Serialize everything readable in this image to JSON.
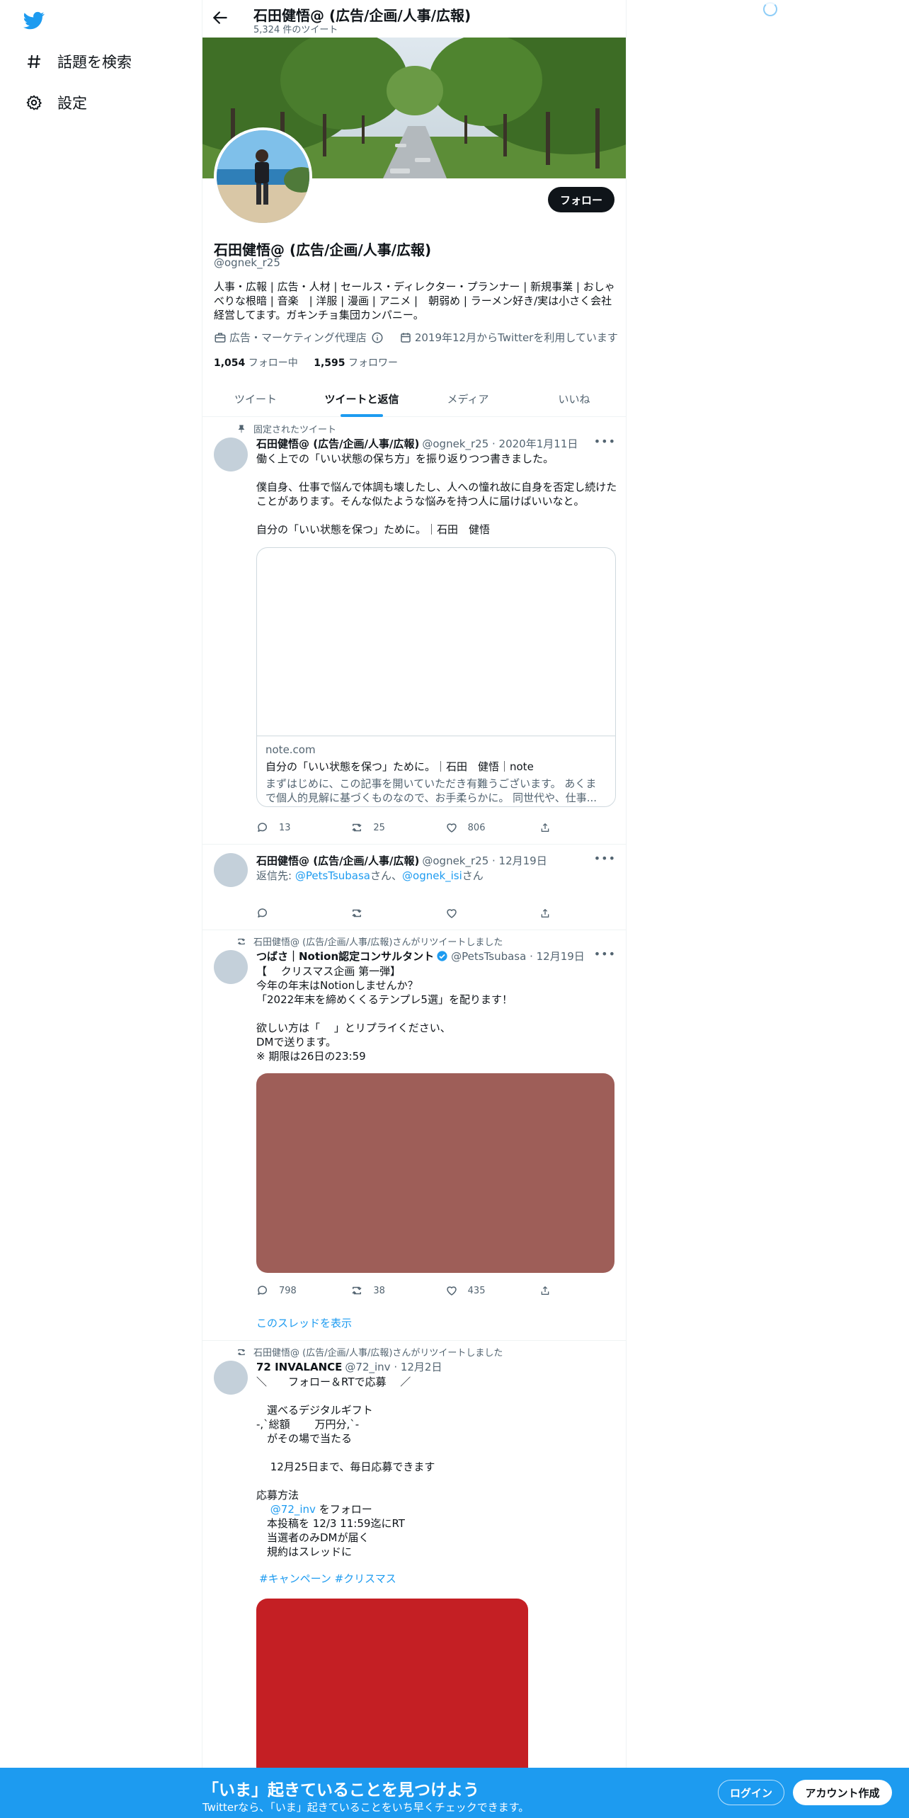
{
  "nav": {
    "items": [
      {
        "label": "話題を検索",
        "icon": "hashtag-icon"
      },
      {
        "label": "設定",
        "icon": "gear-icon"
      }
    ]
  },
  "header": {
    "name": "石田健悟@ (広告/企画/人事/広報)",
    "tweet_count": "5,324 件のツイート"
  },
  "profile": {
    "follow_label": "フォロー",
    "name": "石田健悟@ (広告/企画/人事/広報)",
    "handle": "@ognek_r25",
    "bio": "人事・広報 | 広告・人材 | セールス・ディレクター・プランナー | 新規事業 | おしゃべりな根暗 | 音楽　| 洋服 | 漫画 | アニメ |　朝弱め | ラーメン好き/実は小さく会社経営してます。ガキンチョ集団カンパニー。",
    "category": "広告・マーケティング代理店",
    "joined": "2019年12月からTwitterを利用しています",
    "following_count": "1,054",
    "following_label": "フォロー中",
    "followers_count": "1,595",
    "followers_label": "フォロワー"
  },
  "tabs": [
    "ツイート",
    "ツイートと返信",
    "メディア",
    "いいね"
  ],
  "active_tab": "ツイートと返信",
  "tweets": [
    {
      "context": "固定されたツイート",
      "name": "石田健悟@ (広告/企画/人事/広報)",
      "handle": "@ognek_r25 · 2020年1月11日",
      "text": "働く上での「いい状態の保ち方」を振り返りつつ書きました。\n\n僕自身、仕事で悩んで体調も壊したし、人への憧れ故に自身を否定し続けたことがあります。そんな似たような悩みを持つ人に届けばいいなと。\n\n自分の「いい状態を保つ」ために。｜石田　健悟",
      "card": {
        "domain": "note.com",
        "title": "自分の「いい状態を保つ」ために。｜石田　健悟｜note",
        "description": "まずはじめに、この記事を開いていただき有難うございます。 あくまで個人的見解に基づくものなので、お手柔らかに。 同世代や、仕事..."
      },
      "replies": "13",
      "retweets": "25",
      "likes": "806"
    },
    {
      "name": "石田健悟@ (広告/企画/人事/広報)",
      "handle": "@ognek_r25 · 12月19日",
      "reply_prefix": "返信先: ",
      "reply_user1": "@PetsTsubasa",
      "reply_san1": "さん、",
      "reply_user2": "@ognek_isi",
      "reply_san2": "さん"
    },
    {
      "context": "石田健悟@ (広告/企画/人事/広報)さんがリツイートしました",
      "name": "つばさ｜Notion認定コンサルタント",
      "handle": "@PetsTsubasa · 12月19日",
      "text": "【　 クリスマス企画 第一弾】\n今年の年末はNotionしませんか？\n「2022年末を締めくくるテンプレ5選」を配ります！\n\n欲しい方は「　 」とリプライください、\nDMで送ります。\n※ 期限は26日の23:59",
      "media_color": "#9e5e58",
      "replies": "798",
      "retweets": "38",
      "likes": "435",
      "thread_label": "このスレッドを表示"
    },
    {
      "context": "石田健悟@ (広告/企画/人事/広報)さんがリツイートしました",
      "name": "72 INVALANCE",
      "handle": "@72_inv · 12月2日",
      "text_a": "＼　　フォロー＆RTで応募　 ／\n\n　選べるデジタルギフト\n-,`総額　　 万円分,`-\n　がその場で当たる\n\n　 12月25日まで、毎日応募できます\n\n応募方法\n",
      "text_mention": "@72_inv",
      "text_b": " をフォロー\n　本投稿を 12/3 11:59迄にRT\n　当選者のみDMが届く\n　規約はスレッドに",
      "hashtags": "#キャンペーン #クリスマス",
      "media_color": "#c41f24"
    }
  ],
  "bottom": {
    "title": "「いま」起きていることを見つけよう",
    "subtitle": "Twitterなら、「いま」起きていることをいち早くチェックできます。",
    "login_label": "ログイン",
    "signup_label": "アカウント作成"
  },
  "colors": {
    "accent": "#1d9bf0",
    "text": "#0f1419",
    "secondary": "#536471"
  }
}
